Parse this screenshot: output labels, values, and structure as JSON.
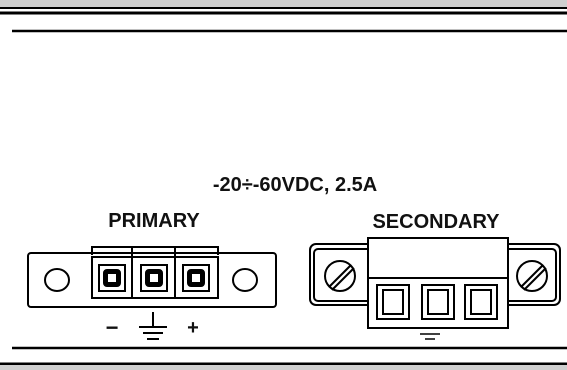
{
  "rating_label": "-20÷-60VDC, 2.5A",
  "primary_label": "PRIMARY",
  "secondary_label": "SECONDARY",
  "primary_polarity": {
    "minus": "−",
    "plus": "+"
  },
  "primary_connector": {
    "terminals": 3
  },
  "secondary_connector": {
    "terminals": 3,
    "screw_flanges": 2
  }
}
